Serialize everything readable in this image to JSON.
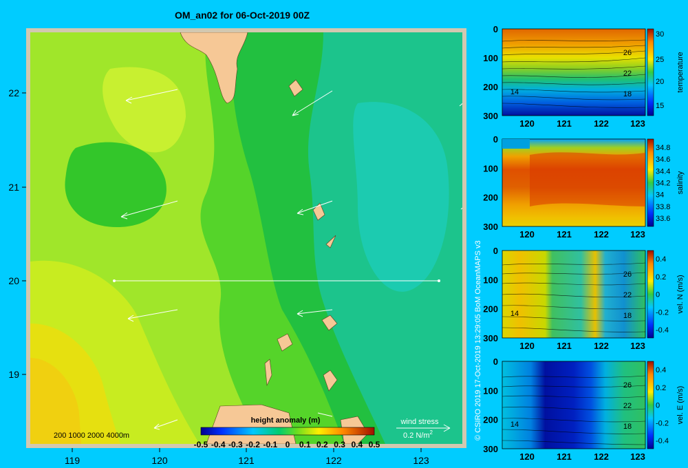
{
  "title": "OM_an02 for 06-Oct-2019 00Z",
  "map": {
    "x_ticks": [
      "119",
      "120",
      "121",
      "122",
      "123"
    ],
    "y_ticks": [
      "22",
      "21",
      "20",
      "19"
    ],
    "depth_legend": "200  1000  2000  4000m",
    "colorbar_title": "height anomaly  (m)",
    "colorbar_ticks": [
      "-0.5",
      "-0.4",
      "-0.3",
      "-0.2",
      "-0.1",
      "0",
      "0.1",
      "0.2",
      "0.3",
      "0.4",
      "0.5"
    ],
    "wind_label": "wind stress",
    "wind_unit": "0.2 N/m",
    "wind_unit_sup": "2"
  },
  "credit": "© CSIRO 2019   17-Oct-2019 13:29:05 BoM OceanMAPS v3",
  "sections": [
    {
      "label": "temperature",
      "x_ticks": [
        "120",
        "121",
        "122",
        "123"
      ],
      "y_ticks": [
        "0",
        "100",
        "200",
        "300"
      ],
      "cbar_ticks": [
        "30",
        "25",
        "20",
        "15"
      ],
      "contours": [
        "26",
        "22",
        "18",
        "14"
      ]
    },
    {
      "label": "salinity",
      "x_ticks": [
        "120",
        "121",
        "122",
        "123"
      ],
      "y_ticks": [
        "0",
        "100",
        "200",
        "300"
      ],
      "cbar_ticks": [
        "34.8",
        "34.6",
        "34.4",
        "34.2",
        "34",
        "33.8",
        "33.6"
      ],
      "contours": []
    },
    {
      "label": "vel. N (m/s)",
      "x_ticks": [
        "120",
        "121",
        "122",
        "123"
      ],
      "y_ticks": [
        "0",
        "100",
        "200",
        "300"
      ],
      "cbar_ticks": [
        "0.4",
        "0.2",
        "0",
        "-0.2",
        "-0.4"
      ],
      "contours": [
        "26",
        "22",
        "18",
        "14"
      ]
    },
    {
      "label": "vel. E (m/s)",
      "x_ticks": [
        "120",
        "121",
        "122",
        "123"
      ],
      "y_ticks": [
        "0",
        "100",
        "200",
        "300"
      ],
      "cbar_ticks": [
        "0.4",
        "0.2",
        "0",
        "-0.2",
        "-0.4"
      ],
      "contours": [
        "26",
        "22",
        "18",
        "14"
      ]
    }
  ]
}
